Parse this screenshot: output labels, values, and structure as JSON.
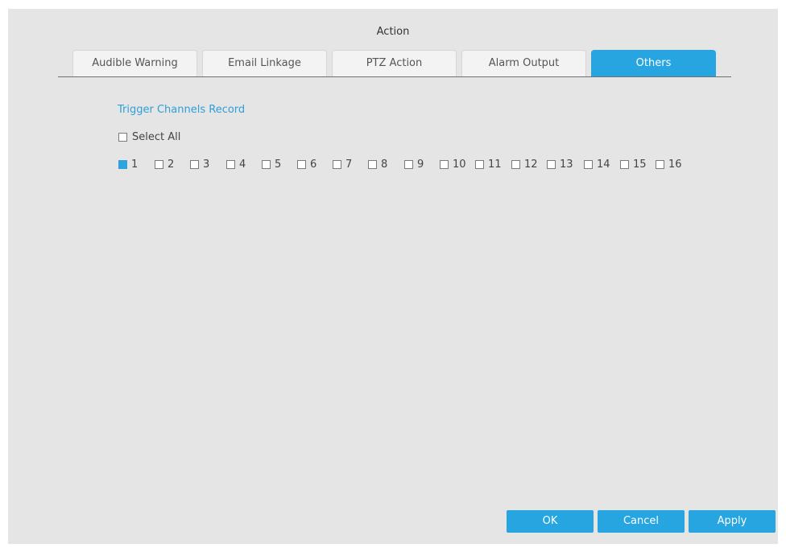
{
  "dialog": {
    "title": "Action"
  },
  "tabs": [
    {
      "label": "Audible Warning",
      "active": false
    },
    {
      "label": "Email Linkage",
      "active": false
    },
    {
      "label": "PTZ Action",
      "active": false
    },
    {
      "label": "Alarm Output",
      "active": false
    },
    {
      "label": "Others",
      "active": true
    }
  ],
  "trigger": {
    "section_title": "Trigger Channels Record",
    "select_all_label": "Select All",
    "select_all_checked": false,
    "channels": [
      {
        "label": "1",
        "checked": true
      },
      {
        "label": "2",
        "checked": false
      },
      {
        "label": "3",
        "checked": false
      },
      {
        "label": "4",
        "checked": false
      },
      {
        "label": "5",
        "checked": false
      },
      {
        "label": "6",
        "checked": false
      },
      {
        "label": "7",
        "checked": false
      },
      {
        "label": "8",
        "checked": false
      },
      {
        "label": "9",
        "checked": false
      },
      {
        "label": "10",
        "checked": false
      },
      {
        "label": "11",
        "checked": false
      },
      {
        "label": "12",
        "checked": false
      },
      {
        "label": "13",
        "checked": false
      },
      {
        "label": "14",
        "checked": false
      },
      {
        "label": "15",
        "checked": false
      },
      {
        "label": "16",
        "checked": false
      }
    ]
  },
  "footer": {
    "ok_label": "OK",
    "cancel_label": "Cancel",
    "apply_label": "Apply"
  },
  "colors": {
    "accent": "#27a5e0",
    "dialog_background": "#e5e5e5",
    "section_title": "#2d9fd9"
  }
}
